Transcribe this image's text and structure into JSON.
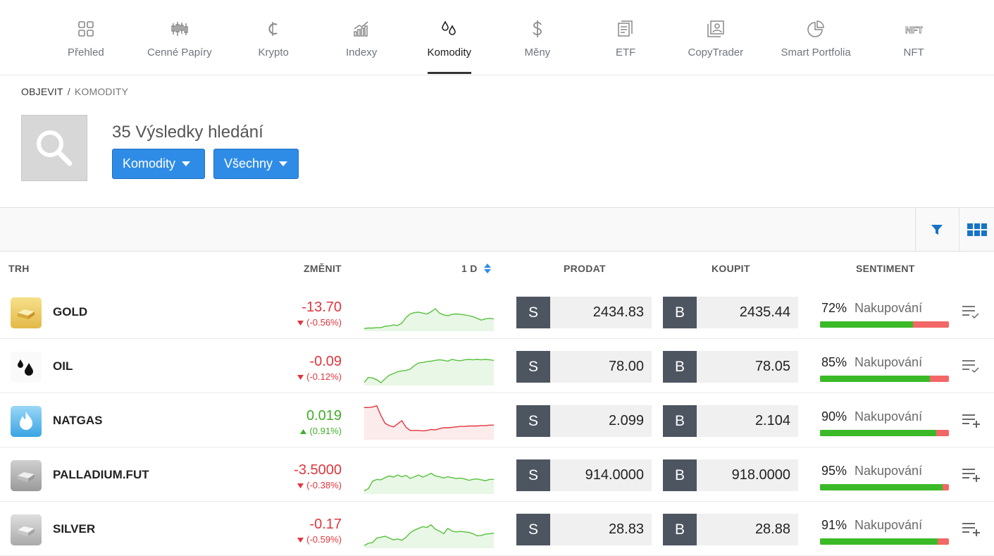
{
  "nav": {
    "items": [
      {
        "label": "Přehled",
        "icon": "grid-icon"
      },
      {
        "label": "Cenné Papíry",
        "icon": "candlestick-icon"
      },
      {
        "label": "Krypto",
        "icon": "crypto-icon"
      },
      {
        "label": "Indexy",
        "icon": "chart-up-icon"
      },
      {
        "label": "Komodity",
        "icon": "drops-icon"
      },
      {
        "label": "Měny",
        "icon": "dollar-icon"
      },
      {
        "label": "ETF",
        "icon": "document-icon"
      },
      {
        "label": "CopyTrader",
        "icon": "person-card-icon"
      },
      {
        "label": "Smart Portfolia",
        "icon": "pie-icon"
      },
      {
        "label": "NFT",
        "icon": "nft-icon"
      }
    ],
    "active": "Komodity"
  },
  "breadcrumb": {
    "root": "OBJEVIT",
    "sep": "/",
    "current": "KOMODITY"
  },
  "results": {
    "title": "35 Výsledky hledání"
  },
  "filters": {
    "category": "Komodity",
    "scope": "Všechny"
  },
  "table": {
    "headers": {
      "market": "TRH",
      "change": "ZMĚNIT",
      "period": "1 D",
      "sell": "PRODAT",
      "buy": "KOUPIT",
      "sentiment": "SENTIMENT"
    },
    "sell_label": "S",
    "buy_label": "B",
    "rows": [
      {
        "name": "GOLD",
        "change": "-13.70",
        "pct": "(-0.56%)",
        "dir": "down",
        "sell": "2434.83",
        "buy": "2435.44",
        "sent_pct": "72%",
        "sent_label": "Nakupování",
        "sent_value": 72,
        "watch": "check",
        "spark": [
          3,
          4,
          4,
          5,
          5,
          8,
          9,
          11,
          10,
          15,
          28,
          36,
          39,
          40,
          38,
          36,
          41,
          48,
          38,
          34,
          32,
          35,
          36,
          35,
          34,
          32,
          30,
          26,
          22,
          25,
          26,
          25
        ]
      },
      {
        "name": "OIL",
        "change": "-0.09",
        "pct": "(-0.12%)",
        "dir": "down",
        "sell": "78.00",
        "buy": "78.05",
        "sent_pct": "85%",
        "sent_label": "Nakupování",
        "sent_value": 85,
        "watch": "check",
        "spark": [
          4,
          15,
          14,
          10,
          3,
          12,
          20,
          24,
          28,
          30,
          31,
          34,
          42,
          48,
          49,
          51,
          52,
          54,
          55,
          54,
          52,
          56,
          54,
          53,
          55,
          56,
          55,
          56,
          55,
          56,
          55,
          54
        ]
      },
      {
        "name": "NATGAS",
        "change": "0.019",
        "pct": "(0.91%)",
        "dir": "up",
        "sell": "2.099",
        "buy": "2.104",
        "sent_pct": "90%",
        "sent_label": "Nakupování",
        "sent_value": 90,
        "watch": "plus",
        "spark": [
          70,
          70,
          71,
          74,
          52,
          34,
          29,
          26,
          33,
          40,
          25,
          18,
          18,
          18,
          17,
          18,
          20,
          19,
          22,
          24,
          24,
          25,
          26,
          27,
          27,
          28,
          28,
          28,
          29,
          29,
          30,
          30
        ]
      },
      {
        "name": "PALLADIUM.FUT",
        "change": "-3.5000",
        "pct": "(-0.38%)",
        "dir": "down",
        "sell": "914.0000",
        "buy": "918.0000",
        "sent_pct": "95%",
        "sent_label": "Nakupování",
        "sent_value": 95,
        "watch": "plus",
        "spark": [
          4,
          9,
          26,
          30,
          29,
          34,
          38,
          35,
          40,
          36,
          39,
          32,
          36,
          40,
          35,
          39,
          44,
          38,
          36,
          33,
          36,
          34,
          32,
          33,
          31,
          28,
          30,
          31,
          29,
          27,
          30,
          30
        ]
      },
      {
        "name": "SILVER",
        "change": "-0.17",
        "pct": "(-0.59%)",
        "dir": "down",
        "sell": "28.83",
        "buy": "28.88",
        "sent_pct": "91%",
        "sent_label": "Nakupování",
        "sent_value": 91,
        "watch": "plus",
        "spark": [
          3,
          8,
          10,
          20,
          22,
          24,
          20,
          16,
          18,
          15,
          22,
          32,
          38,
          42,
          46,
          44,
          50,
          40,
          36,
          30,
          42,
          36,
          34,
          35,
          34,
          33,
          30,
          25,
          26,
          29,
          30,
          31
        ]
      }
    ]
  },
  "colors": {
    "accent": "#2f8ce6",
    "up": "#3fae29",
    "down": "#e0363e",
    "bar_buy": "#3aba27",
    "bar_sell": "#f36767"
  }
}
